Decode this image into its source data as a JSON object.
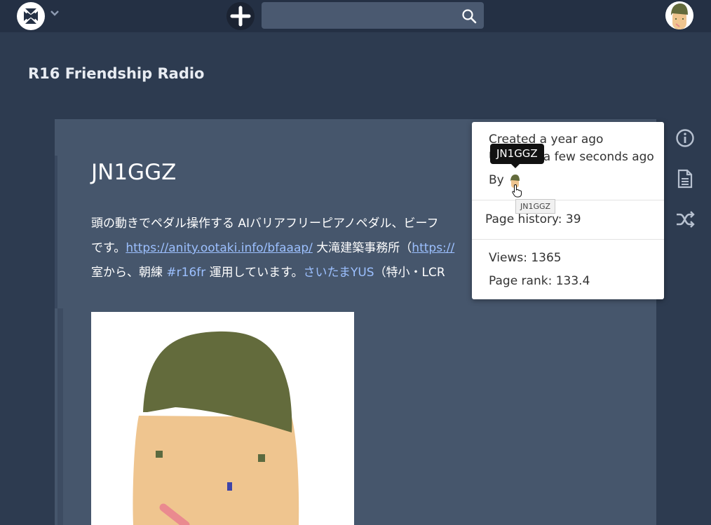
{
  "app": {
    "site_title": "R16 Friendship Radio",
    "search": {
      "placeholder": "",
      "value": ""
    },
    "icons": [
      "logo-icon",
      "chevron-down-icon",
      "plus-icon",
      "search-icon",
      "avatar-icon"
    ]
  },
  "page": {
    "heading": "JN1GGZ",
    "content": {
      "line1": "頭の動きでペダル操作する AIバリアフリーピアノペダル、ビーフ",
      "line2_prefix": "です。",
      "link1": "https://anity.ootaki.info/bfaaap/",
      "line2_middle": " 大滝建築事務所（",
      "link2": "https://",
      "line3_prefix": "室から、朝練 ",
      "hashtag": "#r16fr",
      "line3_middle": " 運用しています。",
      "link3": "さいたまYUS",
      "line3_suffix": "（特小・LCR"
    }
  },
  "sidebar": {
    "icons": [
      "info-icon",
      "document-icon",
      "shuffle-icon"
    ]
  },
  "popover": {
    "created": "Created a year ago",
    "updated": "Updated a few seconds ago",
    "by_label": "By",
    "tooltip": "JN1GGZ",
    "small_tooltip": "JN1GGZ",
    "page_history": "Page history: 39",
    "views": "Views: 1365",
    "page_rank": "Page rank: 133.4"
  },
  "colors": {
    "topbar": "#243044",
    "background": "#2d3b50",
    "card": "#46566c",
    "link": "#9cc0ff",
    "hair": "#636b3c",
    "skin": "#efc58f"
  }
}
